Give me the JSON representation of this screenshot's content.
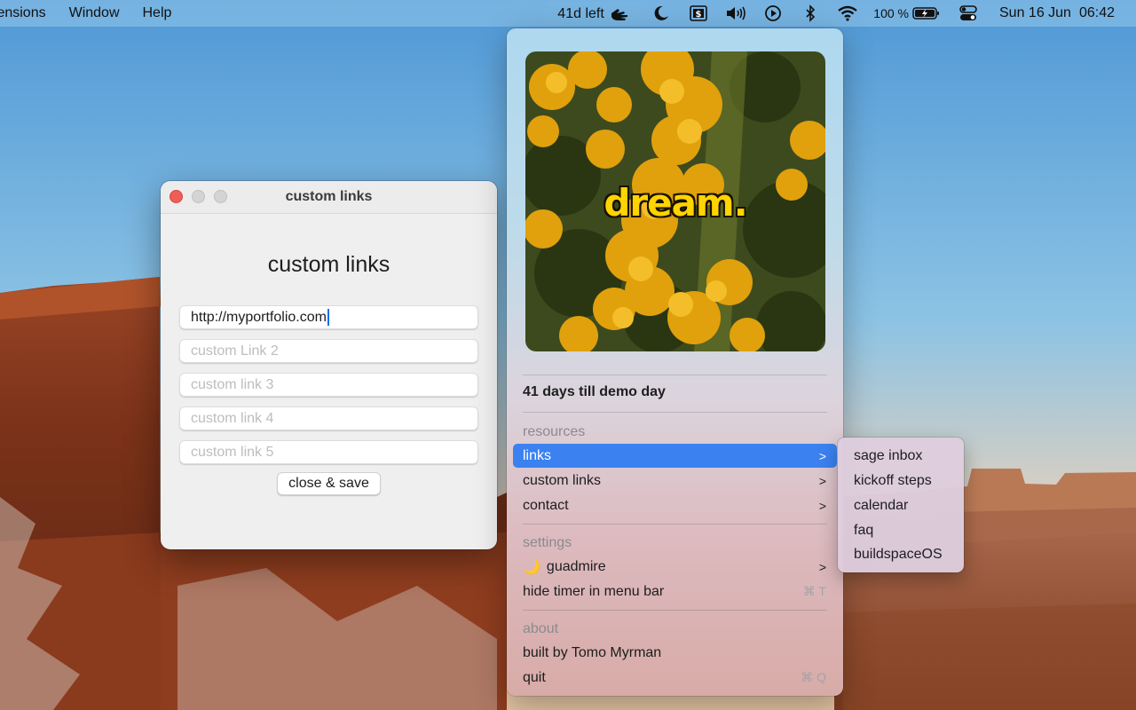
{
  "menubar": {
    "left_items": [
      "tensions",
      "Window",
      "Help"
    ],
    "timer": "41d left",
    "battery_percent": "100 %",
    "clock_day": "Sun 16 Jun",
    "clock_time": "06:42",
    "icons": [
      "hand-icon",
      "moon-icon",
      "dollar-icon",
      "speaker-icon",
      "play-icon",
      "bluetooth-icon",
      "wifi-icon",
      "battery-icon",
      "control-center-icon"
    ]
  },
  "window": {
    "title": "custom links",
    "heading": "custom links",
    "fields": [
      {
        "value": "http://myportfolio.com",
        "placeholder": ""
      },
      {
        "value": "",
        "placeholder": "custom Link 2"
      },
      {
        "value": "",
        "placeholder": "custom link 3"
      },
      {
        "value": "",
        "placeholder": "custom link 4"
      },
      {
        "value": "",
        "placeholder": "custom link 5"
      }
    ],
    "button": "close & save"
  },
  "menu": {
    "artwork_caption": "dream.",
    "countdown": "41 days till demo day",
    "resources_label": "resources",
    "resources": [
      {
        "label": "links",
        "chevron": ">"
      },
      {
        "label": "custom links",
        "chevron": ">"
      },
      {
        "label": "contact",
        "chevron": ">"
      }
    ],
    "settings_label": "settings",
    "settings": [
      {
        "icon": "🌙",
        "label": "guadmire",
        "chevron": ">"
      },
      {
        "label": "hide timer in menu bar",
        "shortcut": "⌘ T"
      }
    ],
    "about_label": "about",
    "about": [
      {
        "label": "built by Tomo Myrman"
      },
      {
        "label": "quit",
        "shortcut": "⌘ Q"
      }
    ]
  },
  "submenu": {
    "items": [
      "sage inbox",
      "kickoff steps",
      "calendar",
      "faq",
      "buildspaceOS"
    ]
  },
  "colors": {
    "accent": "#3b82f0",
    "close_button": "#ee5e56",
    "caption_yellow": "#ffd400"
  }
}
